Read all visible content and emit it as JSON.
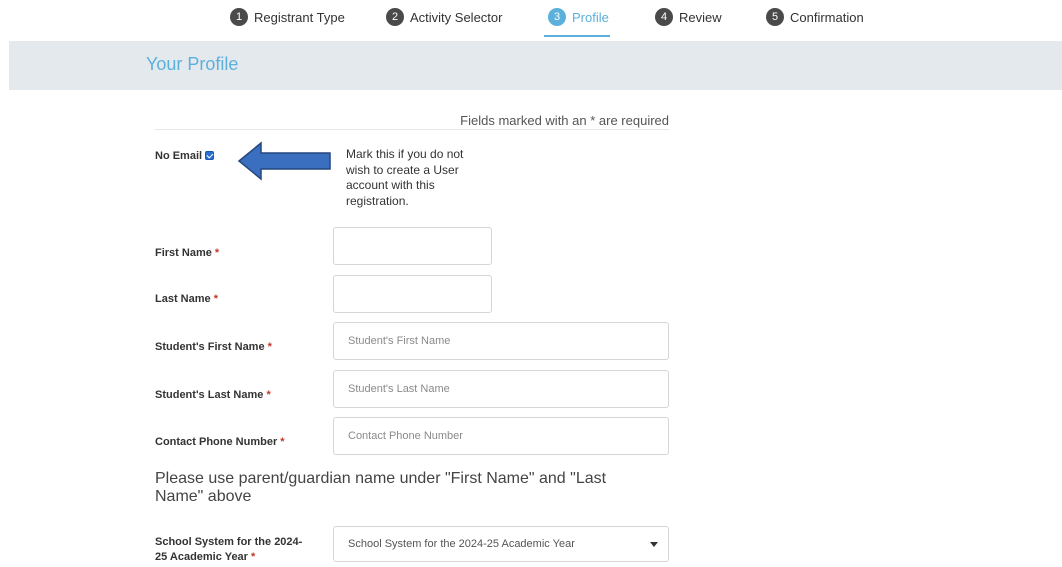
{
  "steps": [
    {
      "num": "1",
      "label": "Registrant Type"
    },
    {
      "num": "2",
      "label": "Activity Selector"
    },
    {
      "num": "3",
      "label": "Profile"
    },
    {
      "num": "4",
      "label": "Review"
    },
    {
      "num": "5",
      "label": "Confirmation"
    }
  ],
  "active_step": "3",
  "header": {
    "title": "Your Profile"
  },
  "form": {
    "required_note": "Fields marked with an * are required",
    "required_marker": "*",
    "no_email": {
      "label": "No Email",
      "checked": true,
      "help_text": "Mark this if you do not wish to create a User account with this registration."
    },
    "first_name": {
      "label": "First Name",
      "value": "",
      "placeholder": ""
    },
    "last_name": {
      "label": "Last Name",
      "value": "",
      "placeholder": ""
    },
    "student_first_name": {
      "label": "Student's First Name",
      "placeholder": "Student's First Name"
    },
    "student_last_name": {
      "label": "Student's Last Name",
      "placeholder": "Student's Last Name"
    },
    "contact_phone": {
      "label": "Contact Phone Number",
      "placeholder": "Contact Phone Number"
    },
    "guardian_note": "Please use parent/guardian name under \"First Name\" and \"Last Name\" above",
    "school_system": {
      "label_line1": "School System for the 2024-",
      "label_line2": "25 Academic Year",
      "placeholder": "School System for the 2024-25 Academic Year"
    }
  },
  "colors": {
    "accent": "#5bb0dc",
    "header_band": "#e4e9ed",
    "required": "#c0392b",
    "arrow": "#3a6fbf"
  }
}
